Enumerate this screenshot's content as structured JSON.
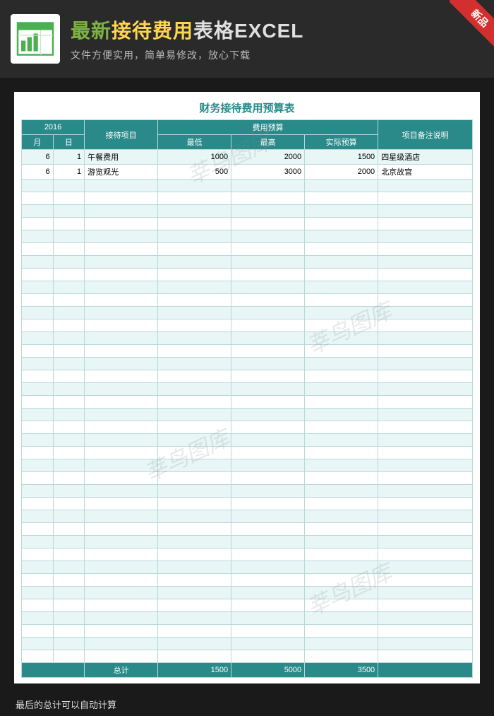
{
  "ribbon": "新品",
  "header": {
    "title_part1": "最新",
    "title_part2": "接待费用",
    "title_part3": "表格EXCEL",
    "subtitle": "文件方便实用，简单易修改，放心下载"
  },
  "sheet": {
    "title": "财务接待费用预算表",
    "year": "2016",
    "headers": {
      "date_group": "2016",
      "month": "月",
      "day": "日",
      "item": "接待项目",
      "budget_group": "费用预算",
      "low": "最低",
      "high": "最高",
      "actual": "实际预算",
      "note": "项目备注说明"
    },
    "rows": [
      {
        "month": "6",
        "day": "1",
        "item": "午餐费用",
        "low": "1000",
        "high": "2000",
        "actual": "1500",
        "note": "四星级酒店"
      },
      {
        "month": "6",
        "day": "1",
        "item": "游览观光",
        "low": "500",
        "high": "3000",
        "actual": "2000",
        "note": "北京故宫"
      }
    ],
    "empty_row_count": 38,
    "totals": {
      "label": "总计",
      "low": "1500",
      "high": "5000",
      "actual": "3500"
    }
  },
  "footer_note": "最后的总计可以自动计算",
  "watermark": "莘鸟图库",
  "chart_data": {
    "type": "table",
    "title": "财务接待费用预算表",
    "columns": [
      "月",
      "日",
      "接待项目",
      "最低",
      "最高",
      "实际预算",
      "项目备注说明"
    ],
    "rows": [
      [
        6,
        1,
        "午餐费用",
        1000,
        2000,
        1500,
        "四星级酒店"
      ],
      [
        6,
        1,
        "游览观光",
        500,
        3000,
        2000,
        "北京故宫"
      ]
    ],
    "totals": {
      "最低": 1500,
      "最高": 5000,
      "实际预算": 3500
    }
  }
}
